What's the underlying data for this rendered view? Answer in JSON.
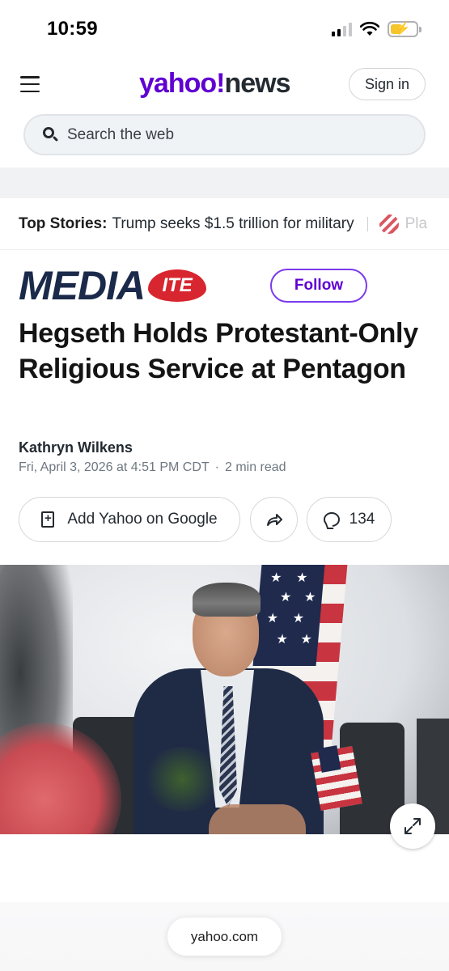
{
  "status_bar": {
    "time": "10:59",
    "icons": [
      "signal-icon",
      "wifi-icon",
      "battery-charging-icon"
    ]
  },
  "header": {
    "logo_yahoo": "yahoo",
    "logo_bang": "!",
    "logo_news": "news",
    "sign_in": "Sign in"
  },
  "search": {
    "placeholder": "Search the web"
  },
  "top_stories": {
    "label": "Top Stories:",
    "headline": "Trump seeks $1.5 trillion for military",
    "next_partial": "Pla"
  },
  "article": {
    "publisher_main": "MEDIA",
    "publisher_badge": "ITE",
    "follow": "Follow",
    "title": "Hegseth Holds Protestant-Only Religious Service at Pentagon",
    "author": "Kathryn Wilkens",
    "date": "Fri, April 3, 2026 at 4:51 PM CDT",
    "separator": "·",
    "read_time": "2 min read",
    "add_google": "Add Yahoo on Google",
    "comment_count": "134"
  },
  "browser": {
    "url": "yahoo.com"
  },
  "colors": {
    "brand_purple": "#6001d2",
    "follow_border": "#7c3aed",
    "publisher_navy": "#1b2a4a",
    "publisher_red": "#d7262f"
  }
}
